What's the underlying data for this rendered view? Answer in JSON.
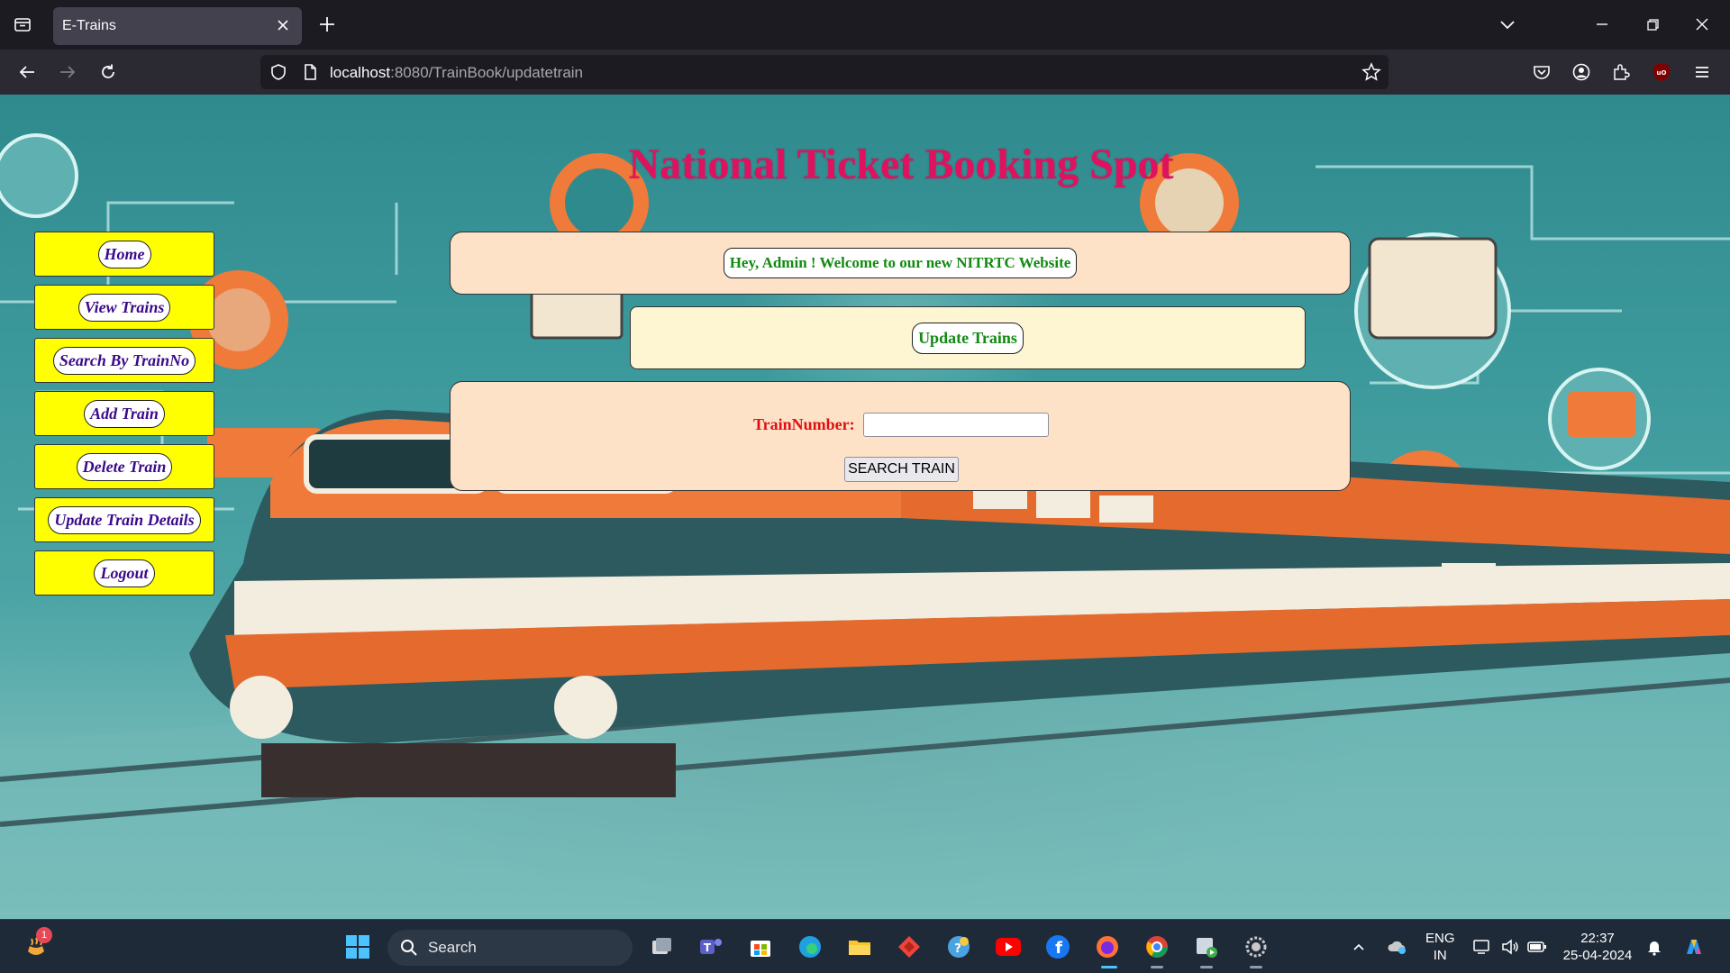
{
  "browser": {
    "tab_title": "E-Trains",
    "url_host": "localhost",
    "url_rest": ":8080/TrainBook/updatetrain"
  },
  "site": {
    "title": "National Ticket Booking Spot",
    "colors": {
      "title": "#e0115f",
      "sidebar_bg": "#ffff00",
      "link_text": "#3a0a8a",
      "green_text": "#138a13",
      "label_red": "#e01010"
    }
  },
  "sidebar": {
    "items": [
      {
        "label": "Home"
      },
      {
        "label": "View Trains"
      },
      {
        "label": "Search By TrainNo"
      },
      {
        "label": "Add Train"
      },
      {
        "label": "Delete Train"
      },
      {
        "label": "Update Train Details"
      },
      {
        "label": "Logout"
      }
    ]
  },
  "welcome": {
    "message": "Hey, Admin ! Welcome to our new NITRTC Website"
  },
  "section": {
    "heading": "Update Trains"
  },
  "form": {
    "label": "TrainNumber:",
    "input_value": "",
    "submit_label": "SEARCH TRAIN"
  },
  "taskbar": {
    "search_label": "Search",
    "notification_count": "1",
    "lang_top": "ENG",
    "lang_bottom": "IN",
    "time": "22:37",
    "date": "25-04-2024",
    "apps": [
      "windows-start-icon",
      "task-view-icon",
      "teams-icon",
      "store-icon",
      "edge-icon",
      "file-explorer-icon",
      "anydesk-icon",
      "chatgpt-icon",
      "youtube-icon",
      "facebook-icon",
      "firefox-icon",
      "chrome-icon",
      "media-player-icon",
      "settings-icon"
    ]
  }
}
